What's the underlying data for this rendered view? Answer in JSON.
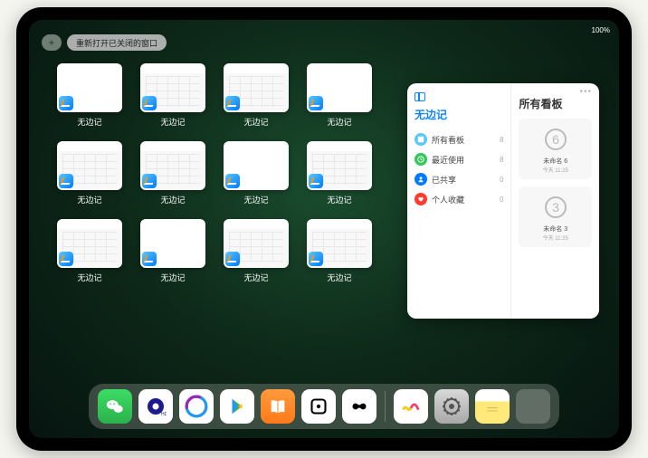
{
  "status": {
    "battery": "100%",
    "wifi": "●●●"
  },
  "top": {
    "plus": "+",
    "reopen": "重新打开已关闭的窗口"
  },
  "app_label": "无边记",
  "grid": [
    {
      "variant": "blank"
    },
    {
      "variant": "calendar"
    },
    {
      "variant": "calendar"
    },
    {
      "variant": "blank"
    },
    {
      "variant": "calendar"
    },
    {
      "variant": "calendar"
    },
    {
      "variant": "blank"
    },
    {
      "variant": "calendar"
    },
    {
      "variant": "calendar"
    },
    {
      "variant": "blank"
    },
    {
      "variant": "calendar"
    },
    {
      "variant": "calendar"
    }
  ],
  "panel": {
    "left_title": "无边记",
    "items": [
      {
        "label": "所有看板",
        "count": "8",
        "color": "#5ac8fa",
        "glyph": "square"
      },
      {
        "label": "最近使用",
        "count": "8",
        "color": "#34c759",
        "glyph": "clock"
      },
      {
        "label": "已共享",
        "count": "0",
        "color": "#007aff",
        "glyph": "person"
      },
      {
        "label": "个人收藏",
        "count": "0",
        "color": "#ff3b30",
        "glyph": "heart"
      }
    ],
    "right_title": "所有看板",
    "boards": [
      {
        "name": "未命名 6",
        "time": "今天 11:25",
        "digit": "6"
      },
      {
        "name": "未命名 3",
        "time": "今天 11:25",
        "digit": "3"
      }
    ]
  },
  "dock": {
    "main": [
      "wechat",
      "quark",
      "qq",
      "play",
      "books",
      "dice",
      "camera"
    ],
    "recent": [
      "freeform",
      "settings",
      "notes",
      "folder"
    ]
  },
  "colors": {
    "accent": "#0a84ff"
  }
}
